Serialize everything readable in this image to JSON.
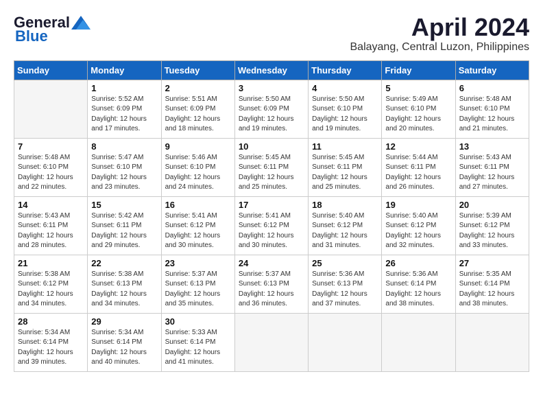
{
  "header": {
    "logo_general": "General",
    "logo_blue": "Blue",
    "month": "April 2024",
    "location": "Balayang, Central Luzon, Philippines"
  },
  "weekdays": [
    "Sunday",
    "Monday",
    "Tuesday",
    "Wednesday",
    "Thursday",
    "Friday",
    "Saturday"
  ],
  "weeks": [
    [
      {
        "day": "",
        "info": ""
      },
      {
        "day": "1",
        "info": "Sunrise: 5:52 AM\nSunset: 6:09 PM\nDaylight: 12 hours\nand 17 minutes."
      },
      {
        "day": "2",
        "info": "Sunrise: 5:51 AM\nSunset: 6:09 PM\nDaylight: 12 hours\nand 18 minutes."
      },
      {
        "day": "3",
        "info": "Sunrise: 5:50 AM\nSunset: 6:09 PM\nDaylight: 12 hours\nand 19 minutes."
      },
      {
        "day": "4",
        "info": "Sunrise: 5:50 AM\nSunset: 6:10 PM\nDaylight: 12 hours\nand 19 minutes."
      },
      {
        "day": "5",
        "info": "Sunrise: 5:49 AM\nSunset: 6:10 PM\nDaylight: 12 hours\nand 20 minutes."
      },
      {
        "day": "6",
        "info": "Sunrise: 5:48 AM\nSunset: 6:10 PM\nDaylight: 12 hours\nand 21 minutes."
      }
    ],
    [
      {
        "day": "7",
        "info": "Sunrise: 5:48 AM\nSunset: 6:10 PM\nDaylight: 12 hours\nand 22 minutes."
      },
      {
        "day": "8",
        "info": "Sunrise: 5:47 AM\nSunset: 6:10 PM\nDaylight: 12 hours\nand 23 minutes."
      },
      {
        "day": "9",
        "info": "Sunrise: 5:46 AM\nSunset: 6:10 PM\nDaylight: 12 hours\nand 24 minutes."
      },
      {
        "day": "10",
        "info": "Sunrise: 5:45 AM\nSunset: 6:11 PM\nDaylight: 12 hours\nand 25 minutes."
      },
      {
        "day": "11",
        "info": "Sunrise: 5:45 AM\nSunset: 6:11 PM\nDaylight: 12 hours\nand 25 minutes."
      },
      {
        "day": "12",
        "info": "Sunrise: 5:44 AM\nSunset: 6:11 PM\nDaylight: 12 hours\nand 26 minutes."
      },
      {
        "day": "13",
        "info": "Sunrise: 5:43 AM\nSunset: 6:11 PM\nDaylight: 12 hours\nand 27 minutes."
      }
    ],
    [
      {
        "day": "14",
        "info": "Sunrise: 5:43 AM\nSunset: 6:11 PM\nDaylight: 12 hours\nand 28 minutes."
      },
      {
        "day": "15",
        "info": "Sunrise: 5:42 AM\nSunset: 6:11 PM\nDaylight: 12 hours\nand 29 minutes."
      },
      {
        "day": "16",
        "info": "Sunrise: 5:41 AM\nSunset: 6:12 PM\nDaylight: 12 hours\nand 30 minutes."
      },
      {
        "day": "17",
        "info": "Sunrise: 5:41 AM\nSunset: 6:12 PM\nDaylight: 12 hours\nand 30 minutes."
      },
      {
        "day": "18",
        "info": "Sunrise: 5:40 AM\nSunset: 6:12 PM\nDaylight: 12 hours\nand 31 minutes."
      },
      {
        "day": "19",
        "info": "Sunrise: 5:40 AM\nSunset: 6:12 PM\nDaylight: 12 hours\nand 32 minutes."
      },
      {
        "day": "20",
        "info": "Sunrise: 5:39 AM\nSunset: 6:12 PM\nDaylight: 12 hours\nand 33 minutes."
      }
    ],
    [
      {
        "day": "21",
        "info": "Sunrise: 5:38 AM\nSunset: 6:12 PM\nDaylight: 12 hours\nand 34 minutes."
      },
      {
        "day": "22",
        "info": "Sunrise: 5:38 AM\nSunset: 6:13 PM\nDaylight: 12 hours\nand 34 minutes."
      },
      {
        "day": "23",
        "info": "Sunrise: 5:37 AM\nSunset: 6:13 PM\nDaylight: 12 hours\nand 35 minutes."
      },
      {
        "day": "24",
        "info": "Sunrise: 5:37 AM\nSunset: 6:13 PM\nDaylight: 12 hours\nand 36 minutes."
      },
      {
        "day": "25",
        "info": "Sunrise: 5:36 AM\nSunset: 6:13 PM\nDaylight: 12 hours\nand 37 minutes."
      },
      {
        "day": "26",
        "info": "Sunrise: 5:36 AM\nSunset: 6:14 PM\nDaylight: 12 hours\nand 38 minutes."
      },
      {
        "day": "27",
        "info": "Sunrise: 5:35 AM\nSunset: 6:14 PM\nDaylight: 12 hours\nand 38 minutes."
      }
    ],
    [
      {
        "day": "28",
        "info": "Sunrise: 5:34 AM\nSunset: 6:14 PM\nDaylight: 12 hours\nand 39 minutes."
      },
      {
        "day": "29",
        "info": "Sunrise: 5:34 AM\nSunset: 6:14 PM\nDaylight: 12 hours\nand 40 minutes."
      },
      {
        "day": "30",
        "info": "Sunrise: 5:33 AM\nSunset: 6:14 PM\nDaylight: 12 hours\nand 41 minutes."
      },
      {
        "day": "",
        "info": ""
      },
      {
        "day": "",
        "info": ""
      },
      {
        "day": "",
        "info": ""
      },
      {
        "day": "",
        "info": ""
      }
    ]
  ]
}
